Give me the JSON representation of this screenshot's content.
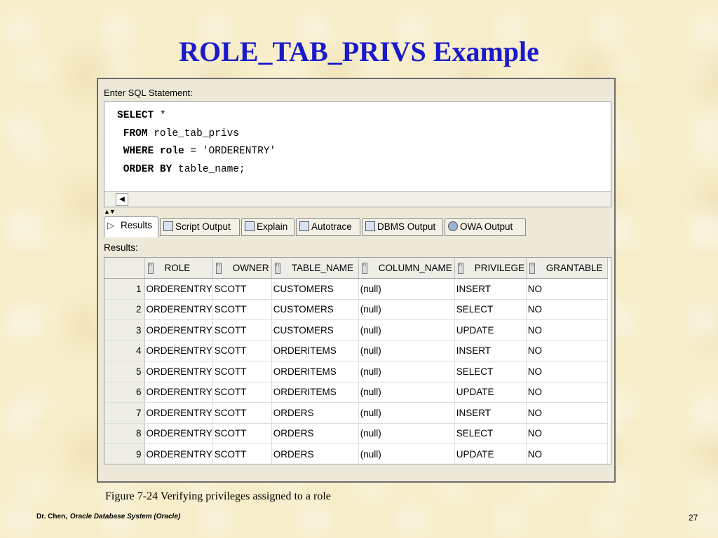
{
  "slide": {
    "title": "ROLE_TAB_PRIVS Example",
    "caption": "Figure 7-24    Verifying privileges assigned to a role",
    "footer_author": "Dr. Chen,",
    "footer_course": "Oracle Database System (Oracle)",
    "page_number": "27"
  },
  "sql": {
    "label": "Enter SQL Statement:",
    "lines": [
      {
        "kw": "SELECT",
        "rest": " *"
      },
      {
        "kw": " FROM",
        "rest": " role_tab_privs"
      },
      {
        "kw": " WHERE role",
        "rest": " = 'ORDERENTRY'"
      },
      {
        "kw": " ORDER BY",
        "rest": " table_name;"
      }
    ]
  },
  "tabs": [
    {
      "label": "Results",
      "icon": "play-icon"
    },
    {
      "label": "Script Output",
      "icon": "script-icon"
    },
    {
      "label": "Explain",
      "icon": "explain-icon"
    },
    {
      "label": "Autotrace",
      "icon": "autotrace-icon"
    },
    {
      "label": "DBMS Output",
      "icon": "dbms-icon"
    },
    {
      "label": "OWA Output",
      "icon": "owa-icon"
    }
  ],
  "results": {
    "label": "Results:",
    "columns": [
      "ROLE",
      "OWNER",
      "TABLE_NAME",
      "COLUMN_NAME",
      "PRIVILEGE",
      "GRANTABLE"
    ],
    "rows": [
      [
        "1",
        "ORDERENTRY",
        "SCOTT",
        "CUSTOMERS",
        "(null)",
        "INSERT",
        "NO"
      ],
      [
        "2",
        "ORDERENTRY",
        "SCOTT",
        "CUSTOMERS",
        "(null)",
        "SELECT",
        "NO"
      ],
      [
        "3",
        "ORDERENTRY",
        "SCOTT",
        "CUSTOMERS",
        "(null)",
        "UPDATE",
        "NO"
      ],
      [
        "4",
        "ORDERENTRY",
        "SCOTT",
        "ORDERITEMS",
        "(null)",
        "INSERT",
        "NO"
      ],
      [
        "5",
        "ORDERENTRY",
        "SCOTT",
        "ORDERITEMS",
        "(null)",
        "SELECT",
        "NO"
      ],
      [
        "6",
        "ORDERENTRY",
        "SCOTT",
        "ORDERITEMS",
        "(null)",
        "UPDATE",
        "NO"
      ],
      [
        "7",
        "ORDERENTRY",
        "SCOTT",
        "ORDERS",
        "(null)",
        "INSERT",
        "NO"
      ],
      [
        "8",
        "ORDERENTRY",
        "SCOTT",
        "ORDERS",
        "(null)",
        "SELECT",
        "NO"
      ],
      [
        "9",
        "ORDERENTRY",
        "SCOTT",
        "ORDERS",
        "(null)",
        "UPDATE",
        "NO"
      ]
    ]
  },
  "colors": {
    "title": "#1a1acc",
    "background": "#f7edc8"
  }
}
